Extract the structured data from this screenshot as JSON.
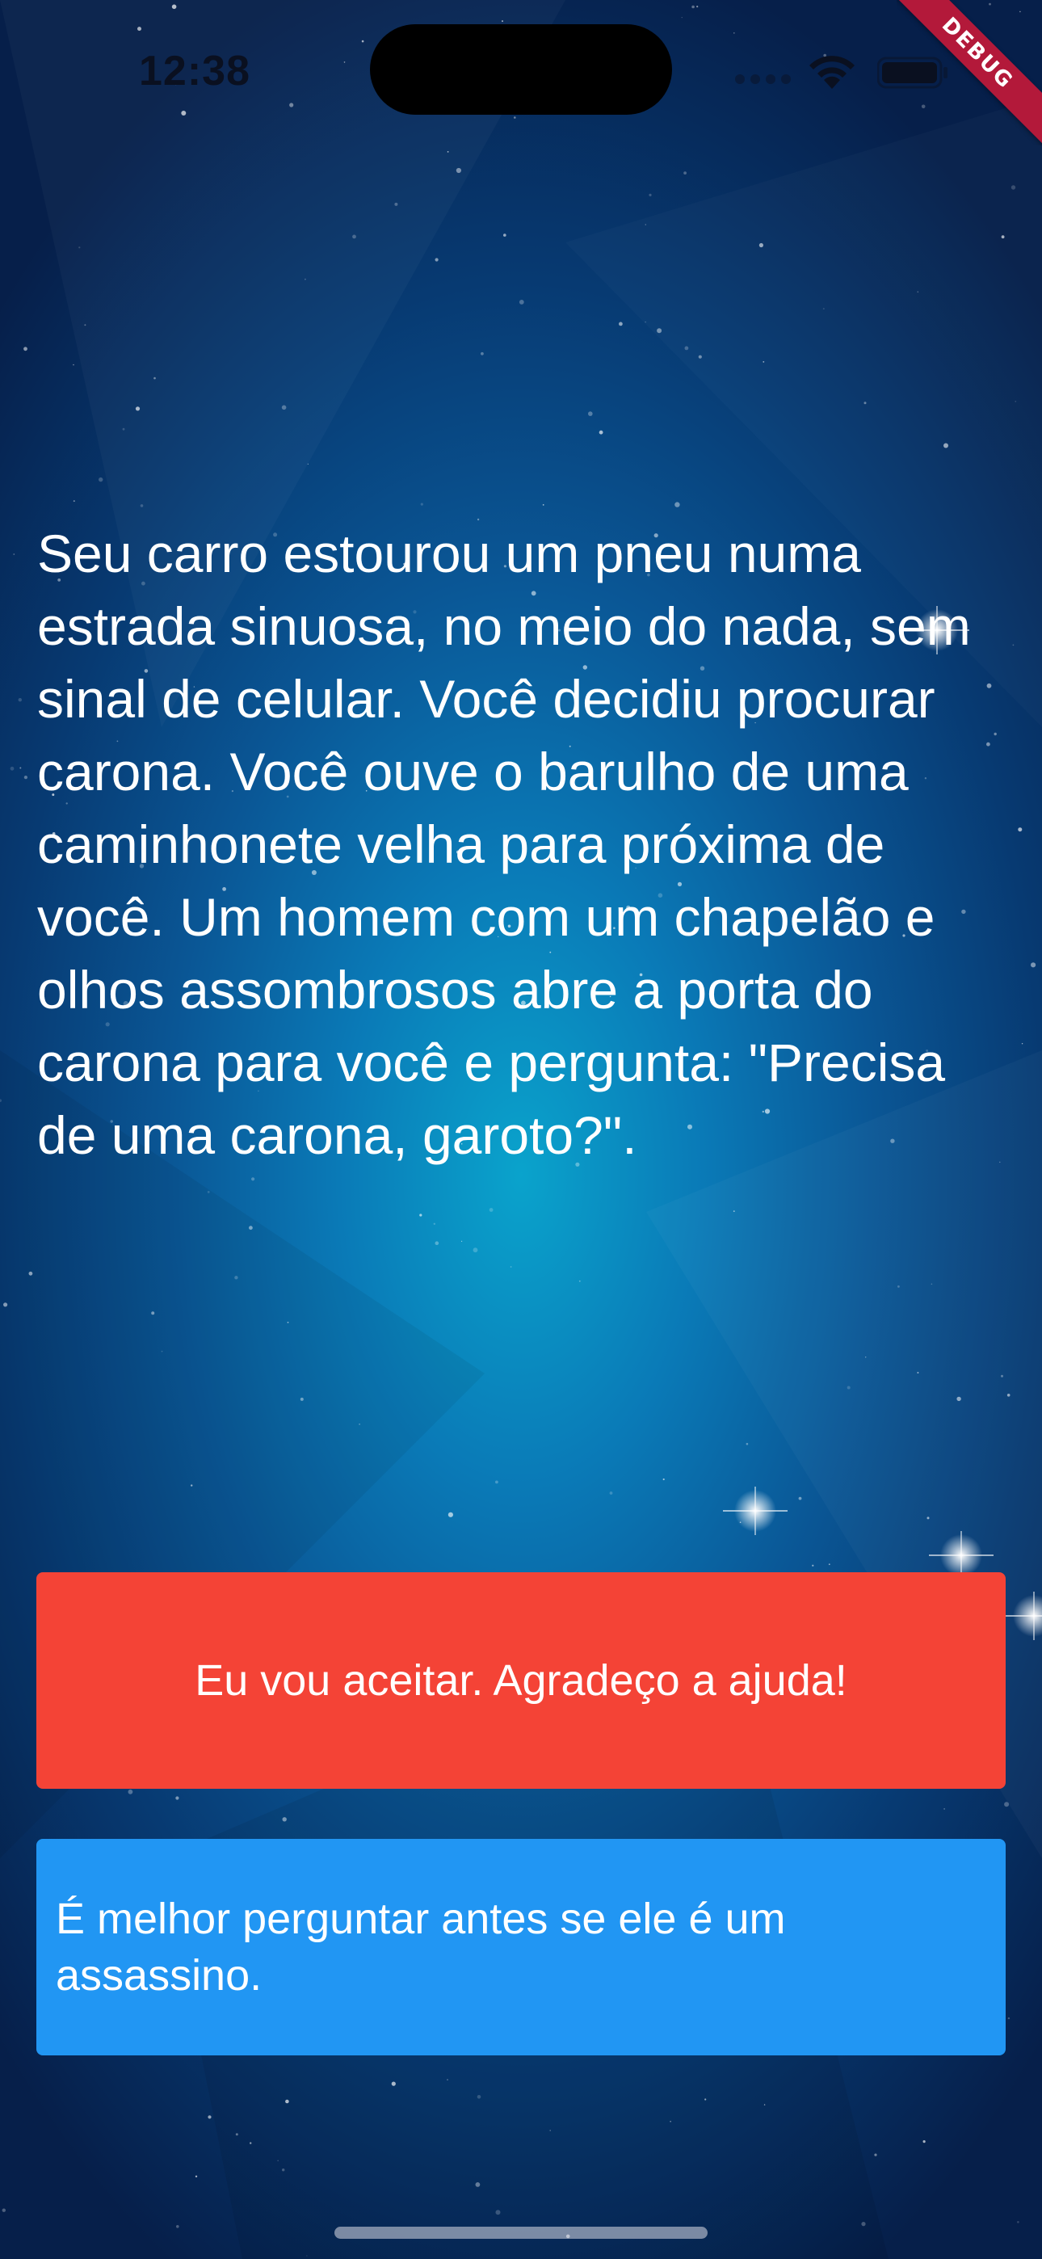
{
  "status_bar": {
    "time": "12:38",
    "icons": [
      "cellular-signal-icon",
      "wifi-icon",
      "battery-icon"
    ]
  },
  "debug_banner": {
    "label": "DEBUG",
    "color": "#b3193a"
  },
  "story": {
    "text": "Seu carro estourou um pneu numa estrada sinuosa, no meio do nada, sem sinal de celular. Você decidiu procurar carona. Você ouve o barulho de uma caminhonete velha para próxima de você. Um homem com um chapelão e olhos assombrosos abre a porta do carona para você e pergunta: \"Precisa de uma carona, garoto?\"."
  },
  "choices": [
    {
      "label": "Eu vou aceitar. Agradeço a ajuda!",
      "color": "#f44336"
    },
    {
      "label": "É melhor perguntar antes se ele é um assassino.",
      "color": "#2196f3"
    }
  ]
}
